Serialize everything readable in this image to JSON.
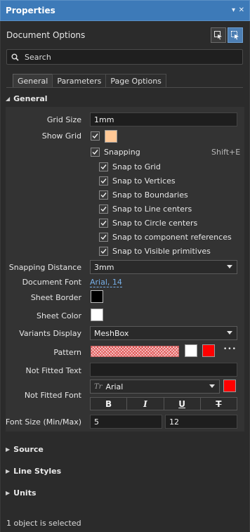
{
  "window": {
    "title": "Properties",
    "pin_glyph": "▾",
    "close_glyph": "✕"
  },
  "header": {
    "title": "Document Options"
  },
  "search": {
    "placeholder": "Search"
  },
  "tabs": [
    {
      "label": "General",
      "active": true
    },
    {
      "label": "Parameters",
      "active": false
    },
    {
      "label": "Page Options",
      "active": false
    }
  ],
  "general": {
    "section_title": "General",
    "grid_size": {
      "label": "Grid Size",
      "value": "1mm"
    },
    "show_grid": {
      "label": "Show Grid",
      "checked": true,
      "color": "#ffc896"
    },
    "snapping": {
      "label": "Snapping",
      "checked": true,
      "shortcut": "Shift+E"
    },
    "snap_options": [
      {
        "label": "Snap to Grid",
        "checked": true
      },
      {
        "label": "Snap to Vertices",
        "checked": true
      },
      {
        "label": "Snap to Boundaries",
        "checked": true
      },
      {
        "label": "Snap to Line centers",
        "checked": true
      },
      {
        "label": "Snap to Circle centers",
        "checked": true
      },
      {
        "label": "Snap to component references",
        "checked": true
      },
      {
        "label": "Snap to Visible primitives",
        "checked": true
      }
    ],
    "snapping_distance": {
      "label": "Snapping Distance",
      "value": "3mm"
    },
    "document_font": {
      "label": "Document Font",
      "value": "Arial, 14"
    },
    "sheet_border": {
      "label": "Sheet Border",
      "color": "#000000"
    },
    "sheet_color": {
      "label": "Sheet Color",
      "color": "#ffffff"
    },
    "variants_display": {
      "label": "Variants Display",
      "value": "MeshBox"
    },
    "pattern": {
      "label": "Pattern",
      "color1": "#ffffff",
      "color2": "#ff0000",
      "more": "•••"
    },
    "not_fitted_text": {
      "label": "Not Fitted Text",
      "value": ""
    },
    "not_fitted_font": {
      "label": "Not Fitted Font",
      "font_name": "Arial",
      "color": "#ff0000"
    },
    "format_buttons": [
      {
        "label": "B",
        "name": "bold"
      },
      {
        "label": "I",
        "name": "italic"
      },
      {
        "label": "U",
        "name": "underline"
      },
      {
        "label": "T",
        "name": "strikethrough"
      }
    ],
    "font_size": {
      "label": "Font Size (Min/Max)",
      "min": "5",
      "max": "12"
    }
  },
  "collapsed_sections": [
    {
      "label": "Source"
    },
    {
      "label": "Line Styles"
    },
    {
      "label": "Units"
    }
  ],
  "status": {
    "text": "1 object is selected"
  }
}
